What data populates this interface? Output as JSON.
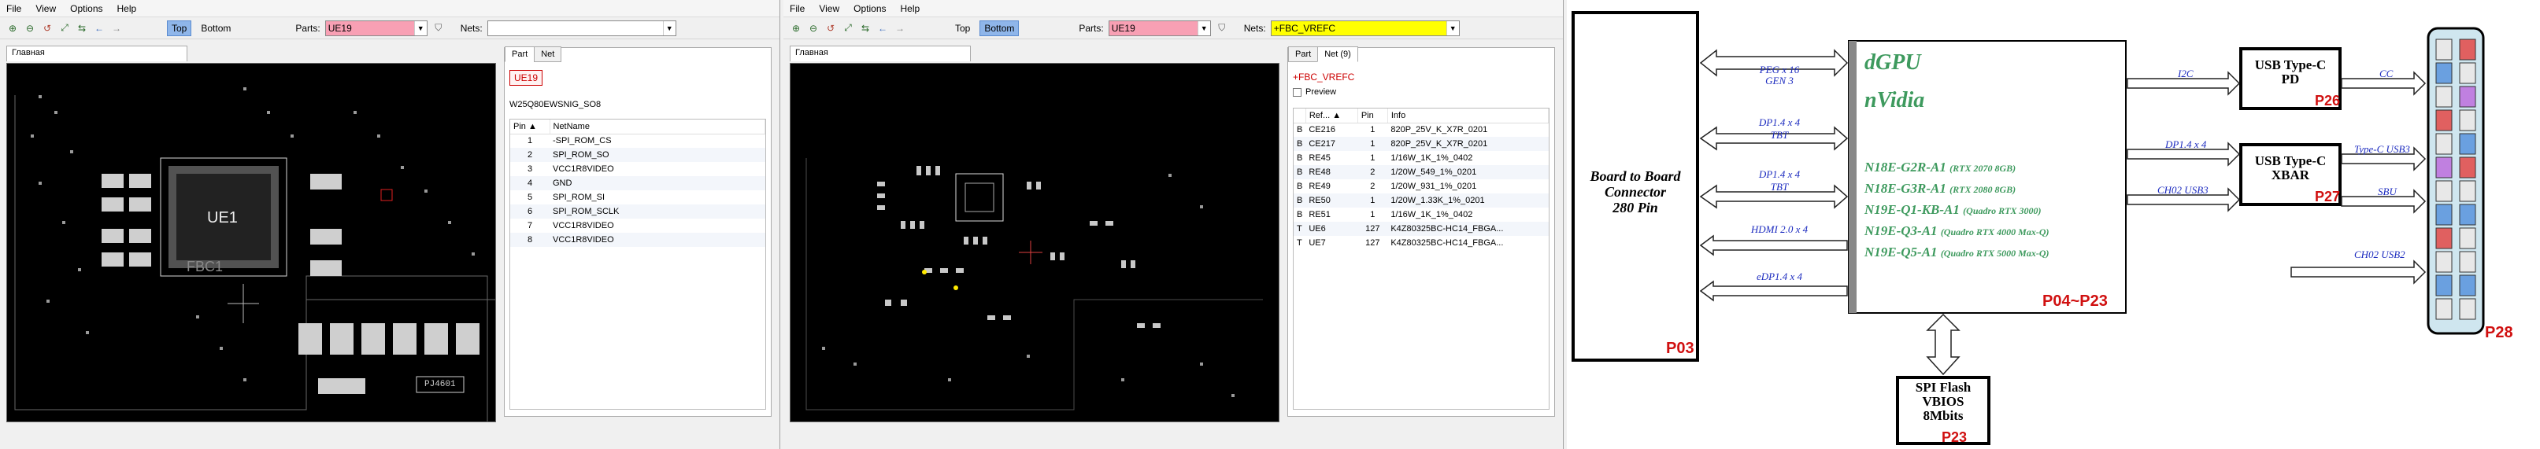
{
  "app": {
    "menu": [
      "File",
      "View",
      "Options",
      "Help"
    ],
    "layer_top": "Top",
    "layer_bottom": "Bottom",
    "parts_label": "Parts:",
    "nets_label": "Nets:"
  },
  "left_window": {
    "parts_value": "UE19",
    "nets_value": "",
    "doc_tab": "Главная",
    "panel_tabs": [
      "Part",
      "Net"
    ],
    "part_name": "UE19",
    "part_desc": "W25Q80EWSNIG_SO8",
    "columns": [
      "Pin",
      "NetName"
    ],
    "pins": [
      {
        "pin": "1",
        "net": "-SPI_ROM_CS"
      },
      {
        "pin": "2",
        "net": "SPI_ROM_SO"
      },
      {
        "pin": "3",
        "net": "VCC1R8VIDEO"
      },
      {
        "pin": "4",
        "net": "GND"
      },
      {
        "pin": "5",
        "net": "SPI_ROM_SI"
      },
      {
        "pin": "6",
        "net": "SPI_ROM_SCLK"
      },
      {
        "pin": "7",
        "net": "VCC1R8VIDEO"
      },
      {
        "pin": "8",
        "net": "VCC1R8VIDEO"
      }
    ],
    "board_labels": {
      "ue1": "UE1",
      "fbc": "FBC1",
      "bottom": "PJ4601"
    }
  },
  "right_window": {
    "parts_value": "UE19",
    "nets_value": "+FBC_VREFC",
    "doc_tab": "Главная",
    "panel_tabs": [
      "Part",
      "Net (9)"
    ],
    "net_name": "+FBC_VREFC",
    "preview_label": "Preview",
    "columns": [
      "",
      "Ref...",
      "Pin",
      "Info"
    ],
    "rows": [
      {
        "s": "B",
        "ref": "CE216",
        "pin": "1",
        "info": "820P_25V_K_X7R_0201"
      },
      {
        "s": "B",
        "ref": "CE217",
        "pin": "1",
        "info": "820P_25V_K_X7R_0201"
      },
      {
        "s": "B",
        "ref": "RE45",
        "pin": "1",
        "info": "1/16W_1K_1%_0402"
      },
      {
        "s": "B",
        "ref": "RE48",
        "pin": "2",
        "info": "1/20W_549_1%_0201"
      },
      {
        "s": "B",
        "ref": "RE49",
        "pin": "2",
        "info": "1/20W_931_1%_0201"
      },
      {
        "s": "B",
        "ref": "RE50",
        "pin": "1",
        "info": "1/20W_1.33K_1%_0201"
      },
      {
        "s": "B",
        "ref": "RE51",
        "pin": "1",
        "info": "1/16W_1K_1%_0402"
      },
      {
        "s": "T",
        "ref": "UE6",
        "pin": "127",
        "info": "K4Z80325BC-HC14_FBGA..."
      },
      {
        "s": "T",
        "ref": "UE7",
        "pin": "127",
        "info": "K4Z80325BC-HC14_FBGA..."
      }
    ]
  },
  "schematic": {
    "b2b": [
      "Board to Board",
      "Connector",
      "280 Pin"
    ],
    "b2b_page": "P03",
    "links": [
      "PEG x 16",
      "GEN 3",
      "DP1.4 x 4",
      "TBT",
      "DP1.4 x 4",
      "TBT",
      "HDMI 2.0 x 4",
      "eDP1.4 x 4"
    ],
    "dgpu_title": "dGPU",
    "dgpu_vendor": "nVidia",
    "dgpu_parts": [
      {
        "part": "N18E-G2R-A1",
        "note": "(RTX 2070 8GB)"
      },
      {
        "part": "N18E-G3R-A1",
        "note": "(RTX 2080 8GB)"
      },
      {
        "part": "N19E-Q1-KB-A1",
        "note": "(Quadro RTX 3000)"
      },
      {
        "part": "N19E-Q3-A1",
        "note": "(Quadro RTX 4000 Max-Q)"
      },
      {
        "part": "N19E-Q5-A1",
        "note": "(Quadro RTX 5000 Max-Q)"
      }
    ],
    "dgpu_page": "P04~P23",
    "usb_pd": [
      "USB Type-C",
      "PD"
    ],
    "usb_pd_page": "P26",
    "usb_xbar": [
      "USB Type-C",
      "XBAR"
    ],
    "usb_xbar_page": "P27",
    "right_links": [
      "I2C",
      "DP1.4 x 4",
      "CH02 USB3",
      "CC",
      "Type-C USB3",
      "SBU",
      "CH02 USB2"
    ],
    "spi": [
      "SPI Flash",
      "VBIOS",
      "8Mbits"
    ],
    "spi_page": "P23",
    "conn_page": "P28",
    "colors": {
      "dgpu_text": "#3e9a5e",
      "link_text": "#1c2bbf",
      "page_text": "#d01010",
      "arrow": "#222222"
    }
  }
}
